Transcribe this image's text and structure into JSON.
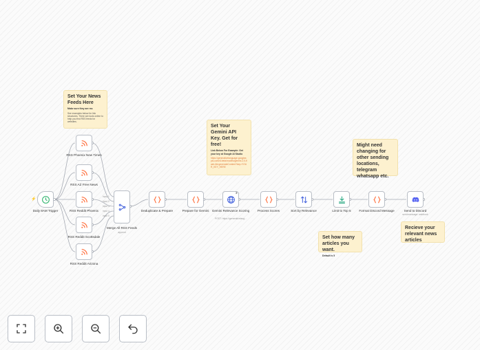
{
  "notes": {
    "feeds": {
      "title": "Set Your News Feeds Here",
      "bold": "Make sure they are rss",
      "body": "See examples below for link structures. There are tools online to help you find RSS feeds for websites."
    },
    "gemini": {
      "title": "Set Your Gemini API Key. Get for free!",
      "bold": "Link Below For Example: Get your key at Google AI Studio",
      "link": "https://generativelanguage.googleapis.com/v1beta/models/gemini-2.0-flash-lite:generateContent?key=YOUR_KEY_HERE"
    },
    "sending": {
      "title": "Might need changing for other sending locations, telegram whatsapp etc."
    },
    "articles": {
      "title": "Set how many articles you want.",
      "bold": "Default is 5"
    },
    "recieve": {
      "title": "Recieve your relevant news articles"
    }
  },
  "nodes": {
    "trigger": {
      "label": "Daily 8AM Trigger",
      "icon": "clock-icon"
    },
    "rss1": {
      "label": "RSS Phoenix New Times",
      "icon": "rss-icon"
    },
    "rss2": {
      "label": "RSS AZ Free News",
      "icon": "rss-icon"
    },
    "rss3": {
      "label": "RSS Reddit Phoenix",
      "icon": "rss-icon"
    },
    "rss4": {
      "label": "RSS Reddit Scottsdale",
      "icon": "rss-icon"
    },
    "rss5": {
      "label": "RSS Reddit Arizona",
      "icon": "rss-icon"
    },
    "merge": {
      "label": "Merge All RSS Feeds",
      "sub": "append",
      "icon": "merge-icon",
      "inputs": [
        "Input 1",
        "Input 2",
        "Input 3",
        "Input 4",
        "Input 5"
      ]
    },
    "dedupe": {
      "label": "Deduplicate & Prepare",
      "icon": "code-braces-icon"
    },
    "prepare": {
      "label": "Prepare for Gemini",
      "icon": "code-braces-icon"
    },
    "gemini": {
      "label": "Gemini Relevance Scoring",
      "sub": "POST: https://generativelang...",
      "badge": "3",
      "icon": "globe-icon"
    },
    "process": {
      "label": "Process Scores",
      "icon": "code-braces-icon"
    },
    "sort": {
      "label": "Sort by Relevance",
      "icon": "sort-arrows-icon"
    },
    "limit": {
      "label": "Limit to Top 5",
      "icon": "limit-icon"
    },
    "format": {
      "label": "Format Discord Message",
      "icon": "code-braces-icon"
    },
    "discord": {
      "label": "Send to Discord",
      "sub": "send:message: webhook",
      "icon": "discord-icon"
    }
  },
  "controls": {
    "fit": "fit-view-icon",
    "zoom_in": "zoom-in-icon",
    "zoom_out": "zoom-out-icon",
    "undo": "undo-icon"
  },
  "colors": {
    "accent": "#ff6d3a",
    "note_bg": "#fdf1cf",
    "node_border": "#b9bec6",
    "globe": "#3b5bdb",
    "sort": "#3b5bdb",
    "limit": "#1aa37a",
    "discord": "#5865f2",
    "clock": "#2db36b"
  }
}
